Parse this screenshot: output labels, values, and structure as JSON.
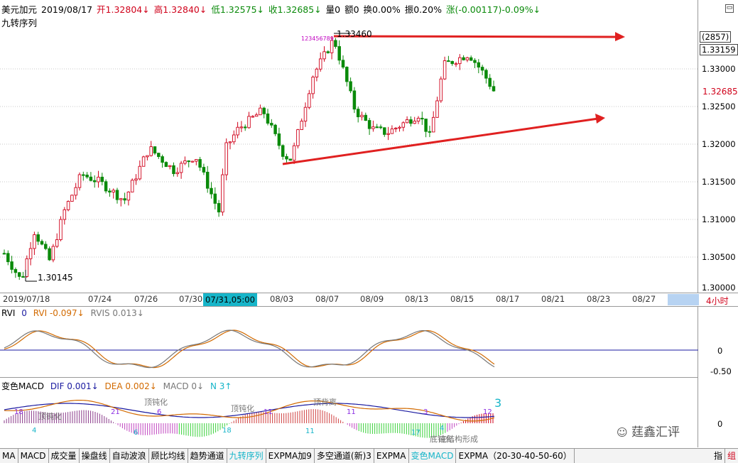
{
  "header": {
    "symbol": "美元加元",
    "date": "2019/08/17",
    "open": "开1.32804↓",
    "high": "高1.32840↓",
    "low": "低1.32575↓",
    "close": "收1.32685↓",
    "volume": "量0",
    "amount": "额0",
    "turnover": "换0.00%",
    "amplitude": "振0.20%",
    "change": "涨(-0.00117)-0.09%↓"
  },
  "indicator_title": "九转序列",
  "price_axis": {
    "labels": [
      "1.33000",
      "1.32500",
      "1.32000",
      "1.31500",
      "1.31000",
      "1.30500",
      "1.30000"
    ],
    "count_badge": "(2857)",
    "top_price": "1.33159",
    "current_price": "1.32685"
  },
  "annotations": {
    "high_label": "1.33460",
    "low_label": "1.30145",
    "nine_seq": "123456789"
  },
  "date_axis": {
    "labels": [
      "2019/07/18",
      "07/24",
      "07/26",
      "07/30",
      "08/03",
      "08/07",
      "08/09",
      "08/13",
      "08/15",
      "08/17",
      "08/21",
      "08/23",
      "08/27"
    ],
    "cursor_label": "07/31,05:00",
    "period": "4小时"
  },
  "rvi": {
    "name": "RVI",
    "param": "0",
    "rvi_value": "RVI -0.097↓",
    "rvis_value": "RVIS 0.013↓",
    "axis": [
      "0",
      "-0.50"
    ]
  },
  "macd": {
    "name": "变色MACD",
    "dif": "DIF 0.001↓",
    "dea": "DEA 0.002↓",
    "macd": "MACD 0↓",
    "n": "N 3↑",
    "axis": [
      "0"
    ],
    "labels": {
      "n18a": "18",
      "n4a": "4",
      "n21": "21",
      "n6a": "6",
      "n6b": "6",
      "n18b": "18",
      "n11a": "11",
      "n11b": "11",
      "n11c": "11",
      "n17": "17",
      "n3a": "3",
      "n4b": "4",
      "n12": "12",
      "n3big": "3",
      "t1": "顶钝化",
      "t2": "顶钝化",
      "t3": "顶钝化",
      "t4": "顶背离",
      "t5": "底钝化",
      "t6": "底结构形成"
    }
  },
  "watermark": "莛鑫汇评",
  "tabs": [
    "MA",
    "MACD",
    "成交量",
    "操盘线",
    "自动波浪",
    "顾比均线",
    "趋势通道",
    "九转序列",
    "EXPMA加9",
    "多空通道(新)3",
    "EXPMA",
    "变色MACD",
    "EXPMA（20-30-40-50-60）"
  ],
  "tabs_right": [
    "指",
    "组"
  ],
  "colors": {
    "up": "#d0021b",
    "down": "#0a8a0a",
    "trend": "#e02020",
    "accent": "#17b5c9"
  }
}
